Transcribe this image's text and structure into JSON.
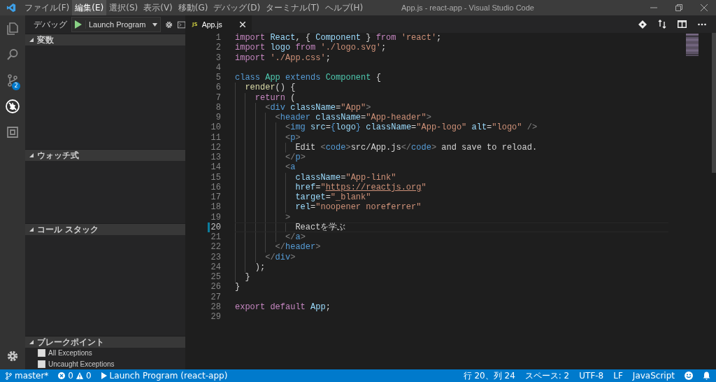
{
  "window": {
    "title": "App.js - react-app - Visual Studio Code"
  },
  "menu": [
    {
      "label": "ファイル(F)",
      "selected": false
    },
    {
      "label": "編集(E)",
      "selected": true
    },
    {
      "label": "選択(S)",
      "selected": false
    },
    {
      "label": "表示(V)",
      "selected": false
    },
    {
      "label": "移動(G)",
      "selected": false
    },
    {
      "label": "デバッグ(D)",
      "selected": false
    },
    {
      "label": "ターミナル(T)",
      "selected": false
    },
    {
      "label": "ヘルプ(H)",
      "selected": false
    }
  ],
  "activity_bar": [
    {
      "kind": "files",
      "selected": false
    },
    {
      "kind": "search",
      "selected": false
    },
    {
      "kind": "git",
      "selected": false,
      "badge": "2"
    },
    {
      "kind": "debug",
      "selected": true
    },
    {
      "kind": "extensions",
      "selected": false
    }
  ],
  "debug_toolbar": {
    "label": "デバッグ",
    "configuration": "Launch Program"
  },
  "sidebar_sections": [
    {
      "title": "変数",
      "expanded": true
    },
    {
      "title": "ウォッチ式",
      "expanded": true
    },
    {
      "title": "コール スタック",
      "expanded": true
    },
    {
      "title": "ブレークポイント",
      "expanded": true,
      "items": [
        {
          "label": "All Exceptions",
          "checked": false
        },
        {
          "label": "Uncaught Exceptions",
          "checked": false
        }
      ]
    }
  ],
  "tabs": [
    {
      "icon": "JS",
      "label": "App.js",
      "selected": true
    }
  ],
  "editor": {
    "lines": [
      {
        "number": "1",
        "current": false,
        "tokens": [
          {
            "kind": "keyword",
            "text": "import "
          },
          {
            "kind": "name",
            "text": "React"
          },
          {
            "kind": "plain",
            "text": ", { "
          },
          {
            "kind": "name",
            "text": "Component"
          },
          {
            "kind": "plain",
            "text": " } "
          },
          {
            "kind": "keyword",
            "text": "from "
          },
          {
            "kind": "string",
            "text": "'react'"
          },
          {
            "kind": "plain",
            "text": ";"
          }
        ]
      },
      {
        "number": "2",
        "current": false,
        "tokens": [
          {
            "kind": "keyword",
            "text": "import "
          },
          {
            "kind": "name",
            "text": "logo "
          },
          {
            "kind": "keyword",
            "text": "from "
          },
          {
            "kind": "string",
            "text": "'./logo.svg'"
          },
          {
            "kind": "plain",
            "text": ";"
          }
        ]
      },
      {
        "number": "3",
        "current": false,
        "tokens": [
          {
            "kind": "keyword",
            "text": "import "
          },
          {
            "kind": "string",
            "text": "'./App.css'"
          },
          {
            "kind": "plain",
            "text": ";"
          }
        ]
      },
      {
        "number": "4",
        "current": false
      },
      {
        "number": "5",
        "current": false,
        "tokens": [
          {
            "kind": "storage",
            "text": "class "
          },
          {
            "kind": "type",
            "text": "App "
          },
          {
            "kind": "storage",
            "text": "extends "
          },
          {
            "kind": "type",
            "text": "Component "
          },
          {
            "kind": "plain",
            "text": "{"
          }
        ]
      },
      {
        "number": "6",
        "current": false,
        "tokens": [
          {
            "kind": "func",
            "text": "  render"
          },
          {
            "kind": "plain",
            "text": "() {"
          }
        ]
      },
      {
        "number": "7",
        "current": false,
        "tokens": [
          {
            "kind": "keyword",
            "text": "    return "
          },
          {
            "kind": "plain",
            "text": "("
          }
        ]
      },
      {
        "number": "8",
        "current": false,
        "tokens": [
          {
            "kind": "bracket",
            "text": "      <"
          },
          {
            "kind": "tag",
            "text": "div "
          },
          {
            "kind": "name",
            "text": "className"
          },
          {
            "kind": "plain",
            "text": "="
          },
          {
            "kind": "string",
            "text": "\"App\""
          },
          {
            "kind": "bracket",
            "text": ">"
          }
        ]
      },
      {
        "number": "9",
        "current": false,
        "tokens": [
          {
            "kind": "bracket",
            "text": "        <"
          },
          {
            "kind": "tag",
            "text": "header "
          },
          {
            "kind": "name",
            "text": "className"
          },
          {
            "kind": "plain",
            "text": "="
          },
          {
            "kind": "string",
            "text": "\"App-header\""
          },
          {
            "kind": "bracket",
            "text": ">"
          }
        ]
      },
      {
        "number": "10",
        "current": false,
        "tokens": [
          {
            "kind": "bracket",
            "text": "          <"
          },
          {
            "kind": "tag",
            "text": "img "
          },
          {
            "kind": "name",
            "text": "src"
          },
          {
            "kind": "plain",
            "text": "="
          },
          {
            "kind": "tag",
            "text": "{"
          },
          {
            "kind": "name",
            "text": "logo"
          },
          {
            "kind": "tag",
            "text": "} "
          },
          {
            "kind": "name",
            "text": "className"
          },
          {
            "kind": "plain",
            "text": "="
          },
          {
            "kind": "string",
            "text": "\"App-logo\" "
          },
          {
            "kind": "name",
            "text": "alt"
          },
          {
            "kind": "plain",
            "text": "="
          },
          {
            "kind": "string",
            "text": "\"logo\" "
          },
          {
            "kind": "bracket",
            "text": "/>"
          }
        ]
      },
      {
        "number": "11",
        "current": false,
        "tokens": [
          {
            "kind": "bracket",
            "text": "          <"
          },
          {
            "kind": "tag",
            "text": "p"
          },
          {
            "kind": "bracket",
            "text": ">"
          }
        ]
      },
      {
        "number": "12",
        "current": false,
        "tokens": [
          {
            "kind": "plain",
            "text": "            Edit "
          },
          {
            "kind": "bracket",
            "text": "<"
          },
          {
            "kind": "tag",
            "text": "code"
          },
          {
            "kind": "bracket",
            "text": ">"
          },
          {
            "kind": "plain",
            "text": "src/App.js"
          },
          {
            "kind": "bracket",
            "text": "</"
          },
          {
            "kind": "tag",
            "text": "code"
          },
          {
            "kind": "bracket",
            "text": ">"
          },
          {
            "kind": "plain",
            "text": " and save to reload."
          }
        ]
      },
      {
        "number": "13",
        "current": false,
        "tokens": [
          {
            "kind": "bracket",
            "text": "          </"
          },
          {
            "kind": "tag",
            "text": "p"
          },
          {
            "kind": "bracket",
            "text": ">"
          }
        ]
      },
      {
        "number": "14",
        "current": false,
        "tokens": [
          {
            "kind": "bracket",
            "text": "          <"
          },
          {
            "kind": "tag",
            "text": "a"
          }
        ]
      },
      {
        "number": "15",
        "current": false,
        "tokens": [
          {
            "kind": "name",
            "text": "            className"
          },
          {
            "kind": "plain",
            "text": "="
          },
          {
            "kind": "string",
            "text": "\"App-link\""
          }
        ]
      },
      {
        "number": "16",
        "current": false,
        "tokens": [
          {
            "kind": "name",
            "text": "            href"
          },
          {
            "kind": "plain",
            "text": "="
          },
          {
            "kind": "string",
            "text": "\""
          },
          {
            "kind": "link",
            "text": "https://reactjs.org"
          },
          {
            "kind": "string",
            "text": "\""
          }
        ]
      },
      {
        "number": "17",
        "current": false,
        "tokens": [
          {
            "kind": "name",
            "text": "            target"
          },
          {
            "kind": "plain",
            "text": "="
          },
          {
            "kind": "string",
            "text": "\"_blank\""
          }
        ]
      },
      {
        "number": "18",
        "current": false,
        "tokens": [
          {
            "kind": "name",
            "text": "            rel"
          },
          {
            "kind": "plain",
            "text": "="
          },
          {
            "kind": "string",
            "text": "\"noopener noreferrer\""
          }
        ]
      },
      {
        "number": "19",
        "current": false,
        "tokens": [
          {
            "kind": "bracket",
            "text": "          >"
          }
        ]
      },
      {
        "number": "20",
        "current": true,
        "modified": true,
        "tokens": [
          {
            "kind": "plain",
            "text": "            Reactを学ぶ"
          }
        ]
      },
      {
        "number": "21",
        "current": false,
        "tokens": [
          {
            "kind": "bracket",
            "text": "          </"
          },
          {
            "kind": "tag",
            "text": "a"
          },
          {
            "kind": "bracket",
            "text": ">"
          }
        ]
      },
      {
        "number": "22",
        "current": false,
        "tokens": [
          {
            "kind": "bracket",
            "text": "        </"
          },
          {
            "kind": "tag",
            "text": "header"
          },
          {
            "kind": "bracket",
            "text": ">"
          }
        ]
      },
      {
        "number": "23",
        "current": false,
        "tokens": [
          {
            "kind": "bracket",
            "text": "      </"
          },
          {
            "kind": "tag",
            "text": "div"
          },
          {
            "kind": "bracket",
            "text": ">"
          }
        ]
      },
      {
        "number": "24",
        "current": false,
        "tokens": [
          {
            "kind": "plain",
            "text": "    );"
          }
        ]
      },
      {
        "number": "25",
        "current": false,
        "tokens": [
          {
            "kind": "plain",
            "text": "  }"
          }
        ]
      },
      {
        "number": "26",
        "current": false,
        "tokens": [
          {
            "kind": "plain",
            "text": "}"
          }
        ]
      },
      {
        "number": "27",
        "current": false
      },
      {
        "number": "28",
        "current": false,
        "tokens": [
          {
            "kind": "keyword",
            "text": "export default "
          },
          {
            "kind": "name",
            "text": "App"
          },
          {
            "kind": "plain",
            "text": ";"
          }
        ]
      },
      {
        "number": "29",
        "current": false
      }
    ]
  },
  "status_bar": {
    "branch": "master*",
    "errors": "0",
    "warnings": "0",
    "launch": "Launch Program (react-app)",
    "right": [
      "行 20、列 24",
      "スペース: 2",
      "UTF-8",
      "LF",
      "JavaScript"
    ]
  }
}
